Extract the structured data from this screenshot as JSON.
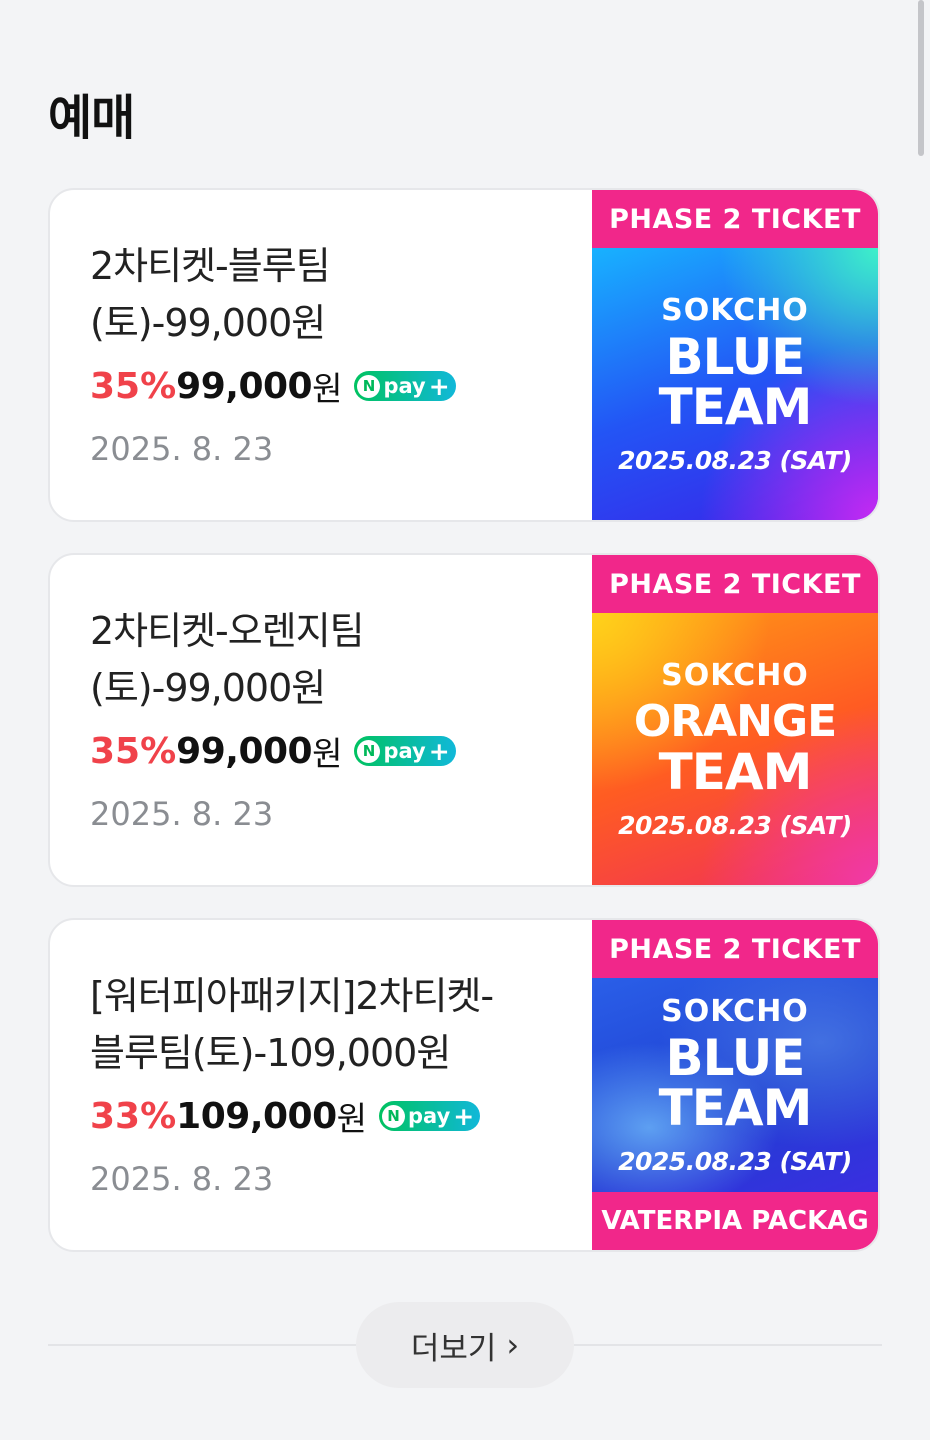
{
  "section": {
    "title": "예매"
  },
  "products": [
    {
      "name_line1": "2차티켓-블루팀",
      "name_line2": "(토)-99,000원",
      "discount": "35%",
      "price": "99,000",
      "currency": "원",
      "npay_label": "pay",
      "date": "2025. 8. 23",
      "thumb": {
        "top": "PHASE 2 TICKET",
        "city": "SOKCHO",
        "team1": "BLUE",
        "team2": "TEAM",
        "date": "2025.08.23 (SAT)"
      }
    },
    {
      "name_line1": "2차티켓-오렌지팀",
      "name_line2": "(토)-99,000원",
      "discount": "35%",
      "price": "99,000",
      "currency": "원",
      "npay_label": "pay",
      "date": "2025. 8. 23",
      "thumb": {
        "top": "PHASE 2 TICKET",
        "city": "SOKCHO",
        "team1": "ORANGE",
        "team2": "TEAM",
        "date": "2025.08.23 (SAT)"
      }
    },
    {
      "name_line1": "[워터피아패키지]2차티켓-",
      "name_line2": "블루팀(토)-109,000원",
      "discount": "33%",
      "price": "109,000",
      "currency": "원",
      "npay_label": "pay",
      "date": "2025. 8. 23",
      "thumb": {
        "top": "PHASE 2 TICKET",
        "city": "SOKCHO",
        "team1": "BLUE",
        "team2": "TEAM",
        "date": "2025.08.23 (SAT)",
        "bottom": "VATERPIA PACKAG"
      }
    }
  ],
  "more": {
    "label": "더보기"
  },
  "colors": {
    "discount": "#f0424a",
    "badge_pink": "#f1278a",
    "npay_green": "#00c260"
  }
}
